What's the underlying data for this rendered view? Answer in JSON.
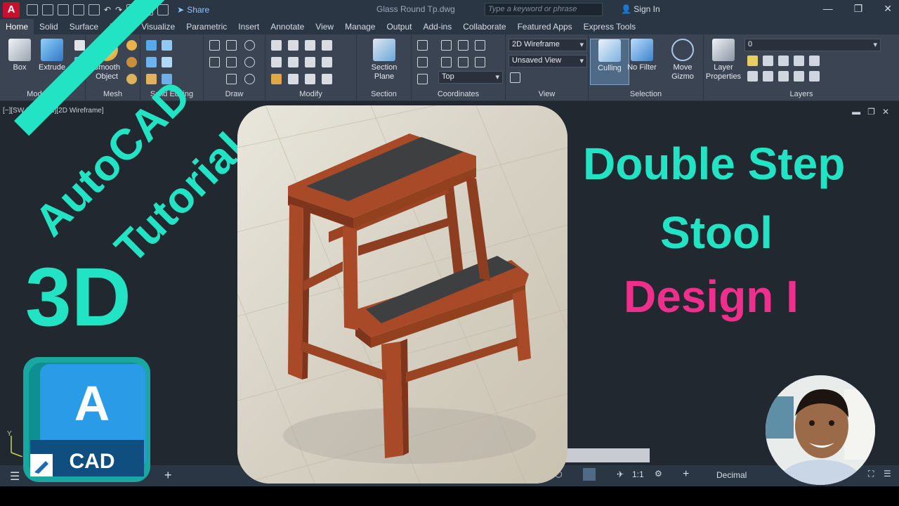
{
  "titlebar": {
    "app_letter": "A",
    "share_label": "Share",
    "document_title": "Glass Round Tp.dwg",
    "search_placeholder": "Type a keyword or phrase",
    "signin_label": "Sign In"
  },
  "tabs": [
    "Home",
    "Solid",
    "Surface",
    "Mesh",
    "Visualize",
    "Parametric",
    "Insert",
    "Annotate",
    "View",
    "Manage",
    "Output",
    "Add-ins",
    "Collaborate",
    "Featured Apps",
    "Express Tools"
  ],
  "ribbon": {
    "box_label": "Box",
    "extrude_label": "Extrude",
    "smooth_label": "Smooth\nObject",
    "section_plane_label": "Section\nPlane",
    "visual_style": "2D Wireframe",
    "saved_view": "Unsaved View",
    "view_direction": "Top",
    "culling_label": "Culling",
    "no_filter_label": "No Filter",
    "move_gizmo_label": "Move\nGizmo",
    "layer_props_label": "Layer\nProperties",
    "layer_current": "0",
    "panels": {
      "modeling": "Modeling",
      "mesh": "Mesh",
      "solid_editing": "Solid Editing",
      "draw": "Draw",
      "modify": "Modify",
      "section": "Section",
      "coordinates": "Coordinates",
      "view": "View",
      "selection": "Selection",
      "layers": "Layers"
    }
  },
  "viewport": {
    "label": "[−][SW Isometric][2D Wireframe]"
  },
  "status": {
    "units": "Decimal",
    "scale": "1:1"
  },
  "overlay": {
    "tutorial_line1": "AutoCAD",
    "tutorial_line2": "Tutorial",
    "three_d": "3D",
    "logo_letter": "A",
    "logo_text": "CAD",
    "title_line1": "Double Step",
    "title_line2": "Stool",
    "title_line3": "Design I"
  },
  "colors": {
    "accent": "#22e3c3",
    "pink": "#ee2f8c",
    "wood": "#a84a28"
  }
}
